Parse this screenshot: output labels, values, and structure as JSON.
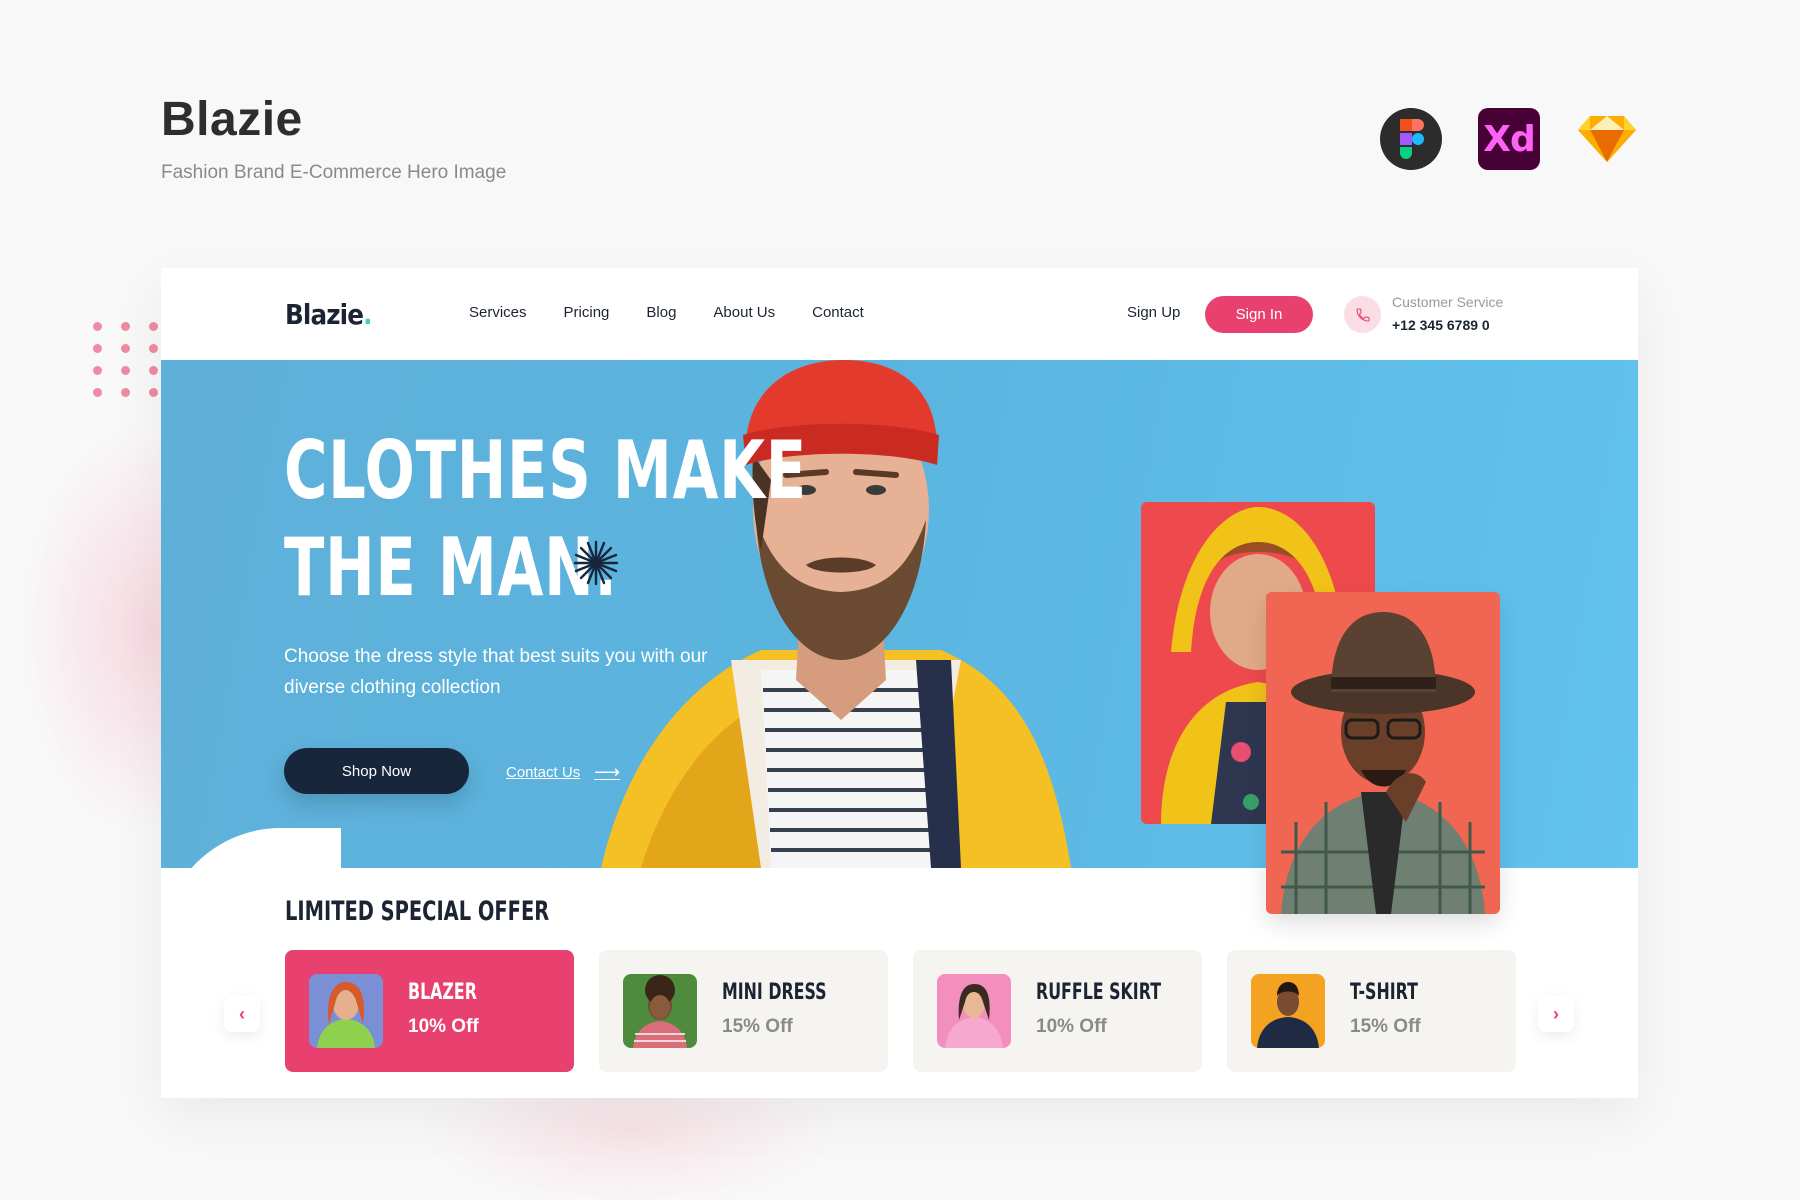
{
  "presentation": {
    "title": "Blazie",
    "subtitle": "Fashion Brand E-Commerce Hero Image",
    "tools": [
      {
        "name": "figma-icon"
      },
      {
        "name": "xd-icon",
        "label": "Xd"
      },
      {
        "name": "sketch-icon"
      }
    ]
  },
  "nav": {
    "logo": "Blazie",
    "logo_dot": ".",
    "links": [
      "Services",
      "Pricing",
      "Blog",
      "About Us",
      "Contact"
    ],
    "signup": "Sign Up",
    "signin": "Sign In",
    "customer_service_label": "Customer Service",
    "customer_service_number": "+12 345 6789 0"
  },
  "hero": {
    "title_line1": "CLOTHES MAKE",
    "title_line2": "THE MAN.",
    "description": "Choose the dress style that best suits you with our diverse clothing collection",
    "shop_button": "Shop Now",
    "contact_link": "Contact Us",
    "contact_arrow": "⟶"
  },
  "offers": {
    "title": "LIMITED SPECIAL OFFER",
    "prev": "‹",
    "next": "›",
    "items": [
      {
        "name": "BLAZER",
        "discount": "10% Off"
      },
      {
        "name": "MINI DRESS",
        "discount": "15% Off"
      },
      {
        "name": "RUFFLE SKIRT",
        "discount": "10% Off"
      },
      {
        "name": "T-SHIRT",
        "discount": "15% Off"
      }
    ]
  },
  "colors": {
    "accent": "#e8416f",
    "dark": "#17263a",
    "hero_bg": "#5ab4df"
  }
}
